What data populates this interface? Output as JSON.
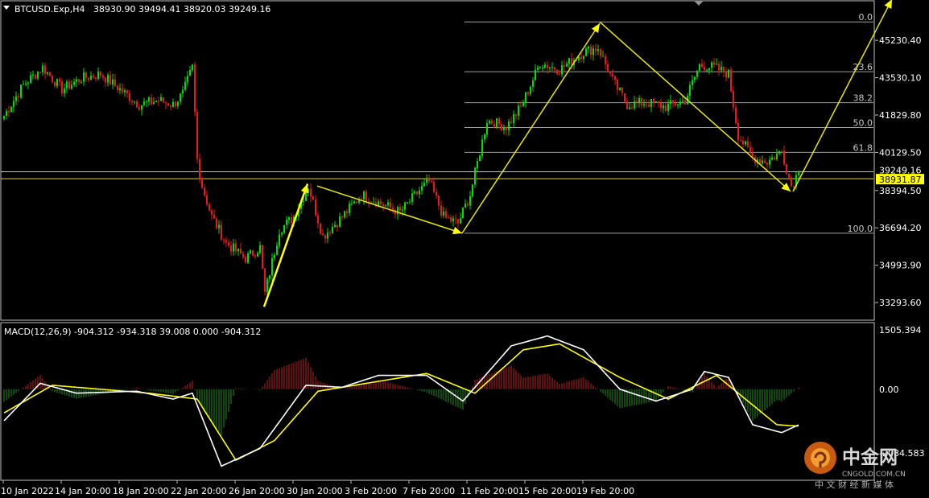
{
  "header": {
    "symbol_label": "BTCUSD.Exp,H4",
    "ohlc": "38930.90 39494.41 38920.03 39249.16"
  },
  "macd_header": "MACD(12,26,9) -904.312 -934.318 39.008 0.000 -904.312",
  "price_labels": [
    "45230.40",
    "43530.10",
    "41829.80",
    "40129.50",
    "38394.50",
    "36694.20",
    "34993.90",
    "33293.60"
  ],
  "current_price_label": "39249.16",
  "highlight_price_label": "38931.87",
  "macd_labels": [
    "1505.394",
    "0.00",
    "-2084.583"
  ],
  "time_labels": [
    "10 Jan 2022",
    "14 Jan 20:00",
    "18 Jan 20:00",
    "22 Jan 20:00",
    "26 Jan 20:00",
    "30 Jan 20:00",
    "3 Feb 20:00",
    "7 Feb 20:00",
    "11 Feb 20:00",
    "15 Feb 20:00",
    "19 Feb 20:00"
  ],
  "fib_labels": [
    "0.0",
    "23.6",
    "38.2",
    "50.0",
    "61.8",
    "100.0"
  ],
  "watermark": {
    "logo_text": "中金网",
    "url_text": "CNGOLD.COM.CN",
    "slogan": "中 文 财 经 新 媒 体"
  },
  "colors": {
    "bull": "#00e000",
    "bear": "#e81919",
    "arrow": "#ffff00",
    "macd_main": "#ffffff",
    "macd_signal": "#ffff00",
    "grid_fib": "#9e9e9e",
    "highlight_bg": "#ffff00"
  },
  "chart_data": {
    "type": "candlestick",
    "symbol": "BTCUSD.Exp",
    "timeframe": "H4",
    "y_range": [
      32600,
      46700
    ],
    "price_ticks": [
      45230.4,
      43530.1,
      41829.8,
      40129.5,
      38394.5,
      36694.2,
      34993.9,
      33293.6
    ],
    "last_price": 39249.16,
    "highlight_price": 38931.87,
    "anchors": [
      {
        "i": 0,
        "p": 41800
      },
      {
        "i": 8,
        "p": 43200
      },
      {
        "i": 16,
        "p": 44000
      },
      {
        "i": 24,
        "p": 43000
      },
      {
        "i": 32,
        "p": 43500
      },
      {
        "i": 40,
        "p": 43700
      },
      {
        "i": 48,
        "p": 43000
      },
      {
        "i": 56,
        "p": 42300
      },
      {
        "i": 64,
        "p": 42500
      },
      {
        "i": 70,
        "p": 42300
      },
      {
        "i": 74,
        "p": 42800
      },
      {
        "i": 78,
        "p": 44000
      },
      {
        "i": 80,
        "p": 39800
      },
      {
        "i": 82,
        "p": 38600
      },
      {
        "i": 86,
        "p": 37200
      },
      {
        "i": 92,
        "p": 36000
      },
      {
        "i": 100,
        "p": 35300
      },
      {
        "i": 106,
        "p": 35800
      },
      {
        "i": 108,
        "p": 33700
      },
      {
        "i": 114,
        "p": 36600
      },
      {
        "i": 120,
        "p": 37200
      },
      {
        "i": 126,
        "p": 38600
      },
      {
        "i": 132,
        "p": 36300
      },
      {
        "i": 140,
        "p": 37200
      },
      {
        "i": 148,
        "p": 38200
      },
      {
        "i": 156,
        "p": 37800
      },
      {
        "i": 164,
        "p": 37400
      },
      {
        "i": 172,
        "p": 38400
      },
      {
        "i": 176,
        "p": 38800
      },
      {
        "i": 182,
        "p": 37200
      },
      {
        "i": 188,
        "p": 36900
      },
      {
        "i": 193,
        "p": 38200
      },
      {
        "i": 200,
        "p": 41600
      },
      {
        "i": 208,
        "p": 41300
      },
      {
        "i": 214,
        "p": 42200
      },
      {
        "i": 222,
        "p": 44200
      },
      {
        "i": 230,
        "p": 43900
      },
      {
        "i": 240,
        "p": 44700
      },
      {
        "i": 246,
        "p": 44900
      },
      {
        "i": 252,
        "p": 43400
      },
      {
        "i": 258,
        "p": 42300
      },
      {
        "i": 266,
        "p": 42400
      },
      {
        "i": 274,
        "p": 42200
      },
      {
        "i": 282,
        "p": 42500
      },
      {
        "i": 288,
        "p": 44100
      },
      {
        "i": 294,
        "p": 44000
      },
      {
        "i": 300,
        "p": 43700
      },
      {
        "i": 304,
        "p": 40900
      },
      {
        "i": 310,
        "p": 39900
      },
      {
        "i": 316,
        "p": 39700
      },
      {
        "i": 322,
        "p": 40200
      },
      {
        "i": 326,
        "p": 38600
      },
      {
        "i": 329,
        "p": 39249
      }
    ],
    "macd": {
      "range": [
        -2084.583,
        1505.394
      ],
      "main_anchors": [
        {
          "i": 0,
          "v": -800
        },
        {
          "i": 15,
          "v": 150
        },
        {
          "i": 30,
          "v": -100
        },
        {
          "i": 55,
          "v": -50
        },
        {
          "i": 70,
          "v": -250
        },
        {
          "i": 78,
          "v": -100
        },
        {
          "i": 90,
          "v": -1950
        },
        {
          "i": 106,
          "v": -1500
        },
        {
          "i": 125,
          "v": 100
        },
        {
          "i": 140,
          "v": 50
        },
        {
          "i": 155,
          "v": 350
        },
        {
          "i": 175,
          "v": 350
        },
        {
          "i": 190,
          "v": -300
        },
        {
          "i": 210,
          "v": 1100
        },
        {
          "i": 225,
          "v": 1350
        },
        {
          "i": 240,
          "v": 1000
        },
        {
          "i": 255,
          "v": 0
        },
        {
          "i": 270,
          "v": -300
        },
        {
          "i": 285,
          "v": 0
        },
        {
          "i": 290,
          "v": 450
        },
        {
          "i": 300,
          "v": 300
        },
        {
          "i": 310,
          "v": -900
        },
        {
          "i": 322,
          "v": -1100
        },
        {
          "i": 329,
          "v": -904
        }
      ],
      "signal_anchors": [
        {
          "i": 0,
          "v": -600
        },
        {
          "i": 20,
          "v": 100
        },
        {
          "i": 40,
          "v": 0
        },
        {
          "i": 60,
          "v": -100
        },
        {
          "i": 80,
          "v": -250
        },
        {
          "i": 96,
          "v": -1800
        },
        {
          "i": 112,
          "v": -1300
        },
        {
          "i": 130,
          "v": -50
        },
        {
          "i": 150,
          "v": 150
        },
        {
          "i": 175,
          "v": 400
        },
        {
          "i": 195,
          "v": -100
        },
        {
          "i": 215,
          "v": 1000
        },
        {
          "i": 230,
          "v": 1150
        },
        {
          "i": 255,
          "v": 300
        },
        {
          "i": 275,
          "v": -250
        },
        {
          "i": 295,
          "v": 350
        },
        {
          "i": 320,
          "v": -900
        },
        {
          "i": 329,
          "v": -934
        }
      ]
    },
    "fibonacci": {
      "high": 46070,
      "low": 36450,
      "levels": [
        {
          "label": "0.0",
          "price": 46070
        },
        {
          "label": "23.6",
          "price": 43800
        },
        {
          "label": "38.2",
          "price": 42390
        },
        {
          "label": "50.0",
          "price": 41260
        },
        {
          "label": "61.8",
          "price": 40130
        },
        {
          "label": "100.0",
          "price": 36450
        }
      ]
    },
    "arrows": [
      {
        "from": {
          "i": 108,
          "p": 33100
        },
        "to": {
          "i": 126,
          "p": 38700
        }
      },
      {
        "from": {
          "i": 130,
          "p": 38600
        },
        "to": {
          "i": 190,
          "p": 36450
        }
      },
      {
        "from": {
          "i": 190,
          "p": 36450
        },
        "to": {
          "i": 247,
          "p": 46000
        }
      },
      {
        "from": {
          "i": 247,
          "p": 46070
        },
        "to": {
          "i": 326,
          "p": 38350
        }
      },
      {
        "from": {
          "i": 327,
          "p": 38350
        },
        "to": {
          "i": 368,
          "p": 47100
        }
      }
    ]
  }
}
